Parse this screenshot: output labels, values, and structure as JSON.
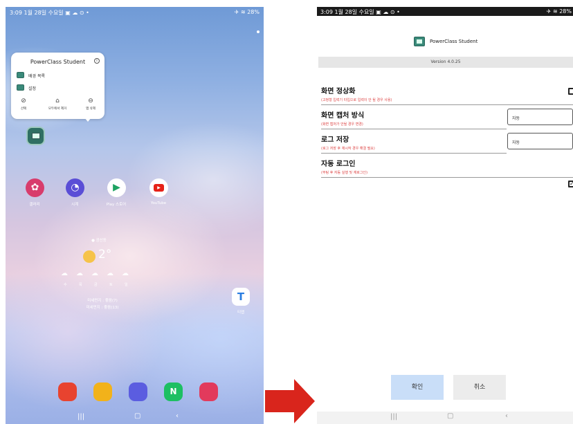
{
  "left_screen": {
    "status_time": "3:09",
    "status_date": "1월 28일 수요일",
    "status_battery": "28%",
    "popup": {
      "title": "PowerClass Student",
      "items": [
        "배경 목록",
        "설정"
      ],
      "actions": [
        "선택",
        "모두에서 제거",
        "앱 삭제"
      ]
    },
    "apps": [
      {
        "label": "갤러리",
        "color": "#d83c6c",
        "icon": "flower-icon"
      },
      {
        "label": "시계",
        "color": "#5a4ed6",
        "icon": "clock-icon"
      },
      {
        "label": "Play 스토어",
        "color": "#ffffff",
        "icon": "play-store-icon"
      },
      {
        "label": "YouTube",
        "color": "#ffffff",
        "icon": "youtube-icon"
      }
    ],
    "weather": {
      "location": "● 광산동",
      "temp": "2°",
      "days": [
        "수",
        "목",
        "금",
        "토",
        "일"
      ],
      "dust1": "미세먼지 : 좋음(7)",
      "dust2": "미세먼지 : 좋음(13)"
    },
    "side_app": {
      "label": "티맵",
      "color": "#ffffff"
    },
    "dock": [
      "#e8432f",
      "#f2b21a",
      "#5b5de0",
      "#1dbf62",
      "#e23a5c"
    ]
  },
  "right_screen": {
    "status_time": "3:09",
    "status_date": "1월 28일 수요일",
    "status_battery": "28%",
    "app_title": "PowerClass Student",
    "version": "Version 4.0.25",
    "settings": [
      {
        "title": "화면 정상화",
        "desc": "(고정형 입력기 타입으로 입력이 안 될 경우 사용)",
        "control": "checkbox",
        "checked": false
      },
      {
        "title": "화면 캡처 방식",
        "desc": "(화면 캡처가 안될 경우 변경)",
        "control": "select",
        "value": "자동"
      },
      {
        "title": "로그 저장",
        "desc": "(로그 저장 후 재시작 경우 해결 필요)",
        "control": "select",
        "value": "자동"
      },
      {
        "title": "자동 로그인",
        "desc": "(부팅 후 자동 실행 및 재로그인)",
        "control": "checkbox",
        "checked": true
      }
    ],
    "confirm_label": "확인",
    "cancel_label": "취소"
  },
  "nav_icons": [
    "recent-apps-icon",
    "home-icon",
    "back-icon"
  ],
  "colors": {
    "arrow": "#d9251c",
    "confirm_bg": "#c9def8",
    "cancel_bg": "#ececec",
    "desc_red": "#dd4444"
  }
}
